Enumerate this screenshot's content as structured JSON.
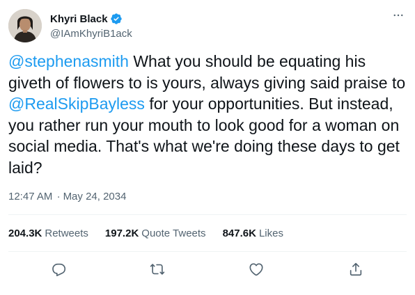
{
  "author": {
    "display_name": "Khyri Black",
    "handle": "@IAmKhyriB1ack",
    "verified": true,
    "avatar_icon": "profile-photo"
  },
  "tweet": {
    "segments": [
      {
        "type": "mention",
        "text": "@stephenasmith"
      },
      {
        "type": "text",
        "text": " What you should be equating his giveth of flowers to is yours, always giving said praise to "
      },
      {
        "type": "mention",
        "text": "@RealSkipBayless"
      },
      {
        "type": "text",
        "text": " for your opportunities. But instead, you rather run your mouth to look good for a woman on social media. That's what we're doing these days to get laid?"
      }
    ],
    "time": "12:47 AM",
    "separator": "·",
    "date": "May 24, 2034"
  },
  "stats": {
    "retweets": {
      "value": "204.3K",
      "label": "Retweets"
    },
    "quote_tweets": {
      "value": "197.2K",
      "label": "Quote Tweets"
    },
    "likes": {
      "value": "847.6K",
      "label": "Likes"
    }
  },
  "icons": {
    "more": "more-horizontal-icon",
    "reply": "reply-icon",
    "retweet": "retweet-icon",
    "like": "heart-icon",
    "share": "share-icon"
  },
  "colors": {
    "link": "#1d9bf0",
    "text": "#0f1419",
    "secondary": "#536471",
    "divider": "#eff3f4",
    "verified": "#1d9bf0"
  }
}
